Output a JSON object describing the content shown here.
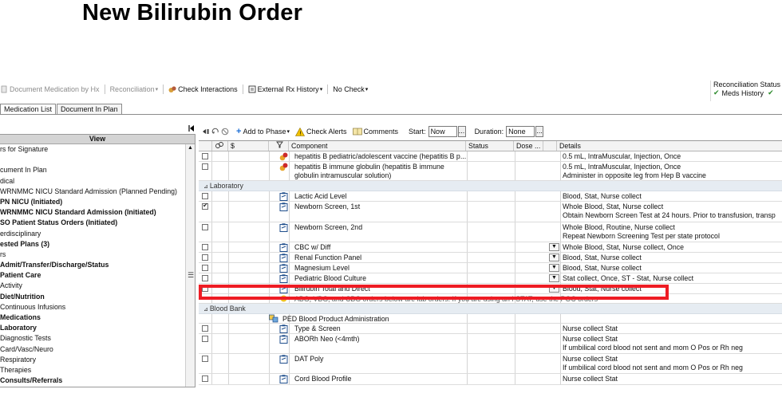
{
  "slide": {
    "title": "New Bilirubin Order"
  },
  "toolbar1": {
    "document_medication": "Document Medication by Hx",
    "reconciliation": "Reconciliation",
    "check_interactions": "Check Interactions",
    "external_rx_history": "External Rx History",
    "no_check": "No Check"
  },
  "recon_status": {
    "title": "Reconciliation Status",
    "meds_history": "Meds History"
  },
  "tabs": [
    "Medication List",
    "Document In Plan"
  ],
  "view": {
    "header": "View",
    "items": [
      {
        "label": "rs for Signature",
        "bold": false
      },
      {
        "label": "",
        "bold": false
      },
      {
        "label": "cument In Plan",
        "bold": false
      },
      {
        "label": "dical",
        "bold": false
      },
      {
        "label": "WRNMMC NICU Standard Admission (Planned Pending)",
        "bold": false
      },
      {
        "label": "PN NICU (Initiated)",
        "bold": true
      },
      {
        "label": "WRNMMC NICU Standard Admission (Initiated)",
        "bold": true
      },
      {
        "label": "SO Patient Status Orders (Initiated)",
        "bold": true
      },
      {
        "label": "erdisciplinary",
        "bold": false
      },
      {
        "label": "ested Plans (3)",
        "bold": true
      },
      {
        "label": "rs",
        "bold": false
      },
      {
        "label": "Admit/Transfer/Discharge/Status",
        "bold": true
      },
      {
        "label": "Patient Care",
        "bold": true
      },
      {
        "label": "Activity",
        "bold": false
      },
      {
        "label": "Diet/Nutrition",
        "bold": true
      },
      {
        "label": "Continuous Infusions",
        "bold": false
      },
      {
        "label": "Medications",
        "bold": true
      },
      {
        "label": "Laboratory",
        "bold": true
      },
      {
        "label": "Diagnostic Tests",
        "bold": false
      },
      {
        "label": "Card/Vasc/Neuro",
        "bold": false
      },
      {
        "label": "Respiratory",
        "bold": false
      },
      {
        "label": "Therapies",
        "bold": false
      },
      {
        "label": "Consults/Referrals",
        "bold": true
      }
    ]
  },
  "toolbar2": {
    "add_to_phase": "Add to Phase",
    "check_alerts": "Check Alerts",
    "comments": "Comments",
    "start_label": "Start:",
    "start_value": "Now",
    "duration_label": "Duration:",
    "duration_value": "None"
  },
  "grid": {
    "columns": {
      "dollar": "$",
      "component": "Component",
      "status": "Status",
      "dose": "Dose ...",
      "details": "Details"
    },
    "rows_top": [
      {
        "component": "hepatitis B pediatric/adolescent vaccine (hepatitis B p...",
        "component2": "",
        "details": "0.5 mL, IntraMuscular, Injection, Once",
        "details2": "",
        "checked": false
      },
      {
        "component": "hepatitis B immune globulin (hepatitis B immune",
        "component2": "globulin intramuscular solution)",
        "details": "0.5 mL, IntraMuscular, Injection, Once",
        "details2": "Administer in opposite leg from Hep B vaccine",
        "checked": false
      }
    ],
    "section_lab": "Laboratory",
    "rows_lab": [
      {
        "component": "Lactic Acid Level",
        "details": "Blood, Stat, Nurse collect",
        "details2": "",
        "checked": false,
        "dropdown": false
      },
      {
        "component": "Newborn Screen, 1st",
        "details": "Whole Blood, Stat, Nurse collect",
        "details2": "Obtain Newborn Screen Test at 24 hours. Prior to transfusion, transp",
        "checked": true,
        "dropdown": false
      },
      {
        "component": "Newborn Screen, 2nd",
        "details": "Whole Blood, Routine, Nurse collect",
        "details2": "Repeat Newborn Screening Test per state protocol",
        "checked": false,
        "dropdown": false
      },
      {
        "component": "CBC w/ Diff",
        "details": "Whole Blood, Stat, Nurse collect, Once",
        "details2": "",
        "checked": false,
        "dropdown": true
      },
      {
        "component": "Renal Function Panel",
        "details": "Blood, Stat, Nurse collect",
        "details2": "",
        "checked": false,
        "dropdown": true
      },
      {
        "component": "Magnesium Level",
        "details": "Blood, Stat, Nurse collect",
        "details2": "",
        "checked": false,
        "dropdown": true
      },
      {
        "component": "Pediatric Blood Culture",
        "details": "Stat collect, Once, ST - Stat, Nurse collect",
        "details2": "",
        "checked": false,
        "dropdown": true
      },
      {
        "component": "Bilirubin Total and Direct",
        "details": "Blood, Stat, Nurse collect",
        "details2": "",
        "checked": false,
        "dropdown": true
      }
    ],
    "lab_note": "ABG, VBG, and CBG orders below are lab orders. If you are using an i-STAT, use the POC orders",
    "section_bb": "Blood Bank",
    "bb_subphase": "PED Blood Product Administration",
    "rows_bb": [
      {
        "component": "Type & Screen",
        "details": "Nurse collect Stat",
        "details2": ""
      },
      {
        "component": "ABORh Neo (<4mth)",
        "details": "Nurse collect Stat",
        "details2": "If umbilical cord blood not sent and mom O Pos or Rh neg"
      },
      {
        "component": "DAT Poly",
        "details": "Nurse collect Stat",
        "details2": "If umbilical cord blood not sent and mom O Pos or Rh neg"
      },
      {
        "component": "Cord Blood Profile",
        "details": "Nurse collect Stat",
        "details2": ""
      }
    ]
  },
  "colors": {
    "highlight": "#ee1c24",
    "section_bg": "#e6ecf2",
    "header_bg": "#d4d4d4"
  }
}
